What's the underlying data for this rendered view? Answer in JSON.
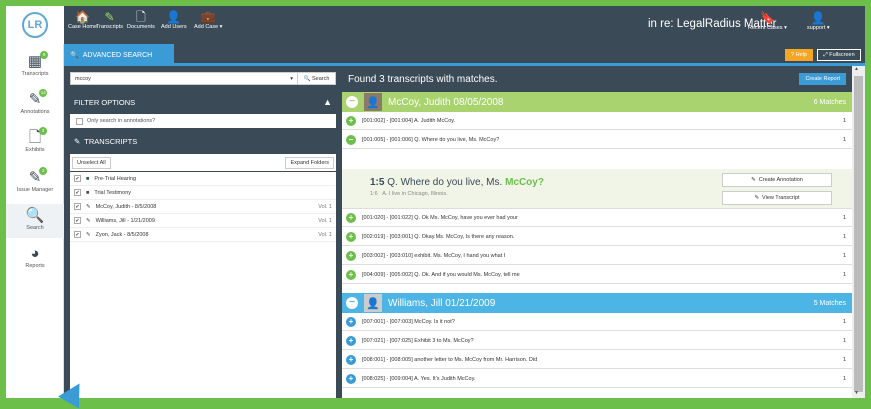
{
  "colors": {
    "green": "#6cc04a",
    "navy": "#3b4a57",
    "blue": "#3a9bd6",
    "wit_green": "#a9d36f",
    "wit_blue": "#4db5e6",
    "orange": "#f5a623"
  },
  "logo": "LR",
  "topnav": [
    {
      "label": "Case Home",
      "icon": "home-icon",
      "glyph": "🏠",
      "active": false
    },
    {
      "label": "Transcripts",
      "icon": "transcript-icon",
      "glyph": "✎",
      "active": true
    },
    {
      "label": "Documents",
      "icon": "document-icon",
      "glyph": "🗋",
      "active": false
    },
    {
      "label": "Add Users",
      "icon": "add-user-icon",
      "glyph": "👤",
      "active": false
    },
    {
      "label": "Add Case ▾",
      "icon": "briefcase-icon",
      "glyph": "💼",
      "active": false
    }
  ],
  "matter_title": "in re: LegalRadius Matter",
  "recent_cases": {
    "label": "Recent Cases ▾",
    "icon": "bookmark-icon",
    "glyph": "🔖"
  },
  "user": {
    "label": "support ▾",
    "icon": "user-circle-icon",
    "glyph": "👤"
  },
  "sidebar": [
    {
      "label": "Transcripts",
      "icon": "grid-icon",
      "glyph": "▦",
      "badge": "9"
    },
    {
      "label": "Annotations",
      "icon": "annotation-icon",
      "glyph": "✎",
      "badge": "14"
    },
    {
      "label": "Exhibits",
      "icon": "exhibit-icon",
      "glyph": "🗋",
      "badge": "3"
    },
    {
      "label": "Issue Manager",
      "icon": "issue-icon",
      "glyph": "✎",
      "badge": "2"
    },
    {
      "label": "Search",
      "icon": "search-icon",
      "glyph": "🔍",
      "badge": ""
    },
    {
      "label": "Reports",
      "icon": "reports-icon",
      "glyph": "◕",
      "badge": ""
    }
  ],
  "adv_search": {
    "title": "ADVANCED SEARCH",
    "help": "? Help",
    "fullscreen": "⤢ Fullscreen"
  },
  "search": {
    "value": "mccoy",
    "button": "🔍 Search"
  },
  "filter": {
    "title": "FILTER OPTIONS",
    "only_annotations": "Only search in annotations?"
  },
  "transcripts_panel": {
    "title": "TRANSCRIPTS",
    "unselect": "Unselect All",
    "expand": "Expand Folders"
  },
  "transcript_list": [
    {
      "label": "Pre-Trial Hearing",
      "type": "folder",
      "vol": ""
    },
    {
      "label": "Trial Testimony",
      "type": "folder",
      "vol": ""
    },
    {
      "label": "McCoy, Judith - 8/5/2008",
      "type": "transcript",
      "vol": "Vol. 1"
    },
    {
      "label": "Williams, Jill - 1/21/2009",
      "type": "transcript",
      "vol": "Vol. 1"
    },
    {
      "label": "Zyon, Jack - 8/5/2008",
      "type": "transcript",
      "vol": "Vol. 1"
    }
  ],
  "results": {
    "found": "Found 3 transcripts with matches.",
    "create_report": "Create Report"
  },
  "witness1": {
    "name": "McCoy, Judith 08/05/2008",
    "matches": "6 Matches"
  },
  "witness2": {
    "name": "Williams, Jill 01/21/2009",
    "matches": "5 Matches"
  },
  "matches1_top": [
    {
      "text": "[001:002] - [001:004] A. Judith McCoy.",
      "count": "1",
      "open": false
    },
    {
      "text": "[001:005] - [001:006] Q. Where do you live, Ms. McCoy?",
      "count": "1",
      "open": true
    }
  ],
  "expanded": {
    "line": "1:5",
    "question_pre": "Q. Where do you live, Ms.",
    "question_hl": "McCoy?",
    "answer_line": "1:6",
    "answer": "A. I live in Chicago, Illinois.",
    "create_annotation": "Create Annotation",
    "view_transcript": "View Transcript"
  },
  "matches1_bottom": [
    {
      "text": "[001:020] - [001:022] Q. Ok Ms. McCoy, have you ever had your",
      "count": "1"
    },
    {
      "text": "[002:019] - [003:001] Q. Okay.Ms. McCoy, Is there any reason.",
      "count": "1"
    },
    {
      "text": "[003:002] - [003:010] exhibit. Ms. McCoy, I hand you what I",
      "count": "1"
    },
    {
      "text": "[004:009] - [005:002] Q. Ok. And if you would Ms. McCoy, tell me",
      "count": "1"
    }
  ],
  "matches2": [
    {
      "text": "[007:001] - [007:003] McCoy. Is it not?",
      "count": "1"
    },
    {
      "text": "[007:021] - [007:025] Exhibit 3 to Ms. McCoy?",
      "count": "1"
    },
    {
      "text": "[008:001] - [008:005] another letter to Ms. McCoy from Mr. Harrison. Did",
      "count": "1"
    },
    {
      "text": "[008:025] - [009:004] A. Yes. It's Judith McCoy.",
      "count": "1"
    }
  ]
}
